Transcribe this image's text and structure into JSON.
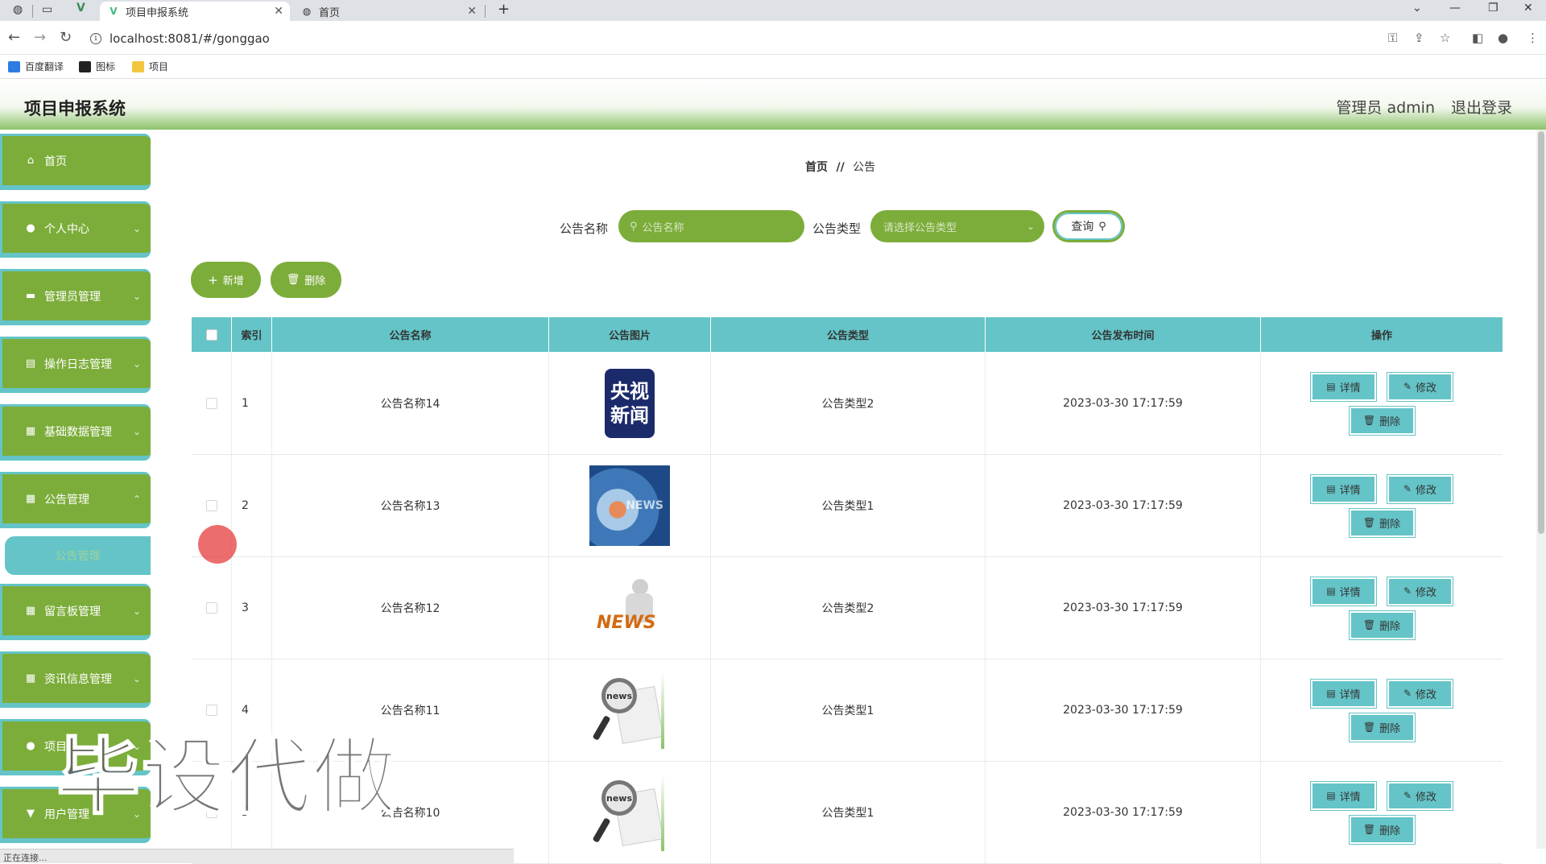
{
  "browser": {
    "tabs": [
      {
        "title": "项目申报系统",
        "active": true
      },
      {
        "title": "首页",
        "active": false
      }
    ],
    "url": "localhost:8081/#/gonggao",
    "bookmarks": [
      "百度翻译",
      "图标",
      "项目"
    ],
    "status_text": "正在连接..."
  },
  "header": {
    "title": "项目申报系统",
    "admin_label": "管理员 admin",
    "logout_label": "退出登录"
  },
  "sidebar": {
    "items": [
      {
        "label": "首页",
        "icon": "home-icon"
      },
      {
        "label": "个人中心",
        "icon": "user-icon"
      },
      {
        "label": "管理员管理",
        "icon": "monitor-icon"
      },
      {
        "label": "操作日志管理",
        "icon": "clipboard-icon"
      },
      {
        "label": "基础数据管理",
        "icon": "grid-icon"
      },
      {
        "label": "公告管理",
        "icon": "grid-icon"
      },
      {
        "label": "留言板管理",
        "icon": "grid-icon"
      },
      {
        "label": "资讯信息管理",
        "icon": "grid-icon"
      },
      {
        "label": "项目",
        "icon": "user-icon"
      },
      {
        "label": "用户管理",
        "icon": "cup-icon"
      }
    ],
    "active_sub": "公告管理"
  },
  "breadcrumb": {
    "home": "首页",
    "sep": "//",
    "current": "公告"
  },
  "search": {
    "name_label": "公告名称",
    "name_placeholder": "公告名称",
    "type_label": "公告类型",
    "type_placeholder": "请选择公告类型",
    "query_label": "查询"
  },
  "actions": {
    "add_label": "新增",
    "delete_label": "删除"
  },
  "table": {
    "columns": [
      "索引",
      "公告名称",
      "公告图片",
      "公告类型",
      "公告发布时间",
      "操作"
    ],
    "op_labels": {
      "detail": "详情",
      "edit": "修改",
      "delete": "删除"
    },
    "rows": [
      {
        "index": "1",
        "name": "公告名称14",
        "type": "公告类型2",
        "time": "2023-03-30 17:17:59",
        "image": "cctv-news"
      },
      {
        "index": "2",
        "name": "公告名称13",
        "type": "公告类型1",
        "time": "2023-03-30 17:17:59",
        "image": "news-globe"
      },
      {
        "index": "3",
        "name": "公告名称12",
        "type": "公告类型2",
        "time": "2023-03-30 17:17:59",
        "image": "news-figure"
      },
      {
        "index": "4",
        "name": "公告名称11",
        "type": "公告类型1",
        "time": "2023-03-30 17:17:59",
        "image": "news-magnifier"
      },
      {
        "index": "5",
        "name": "公告名称10",
        "type": "公告类型1",
        "time": "2023-03-30 17:17:59",
        "image": "news-magnifier"
      }
    ]
  },
  "image_text": {
    "cctv_top": "央视",
    "cctv_bottom": "新闻",
    "news_word": "NEWS",
    "news_small": "news"
  },
  "watermark": "毕设代做",
  "colors": {
    "green": "#7cad3a",
    "teal": "#64c4c7"
  }
}
